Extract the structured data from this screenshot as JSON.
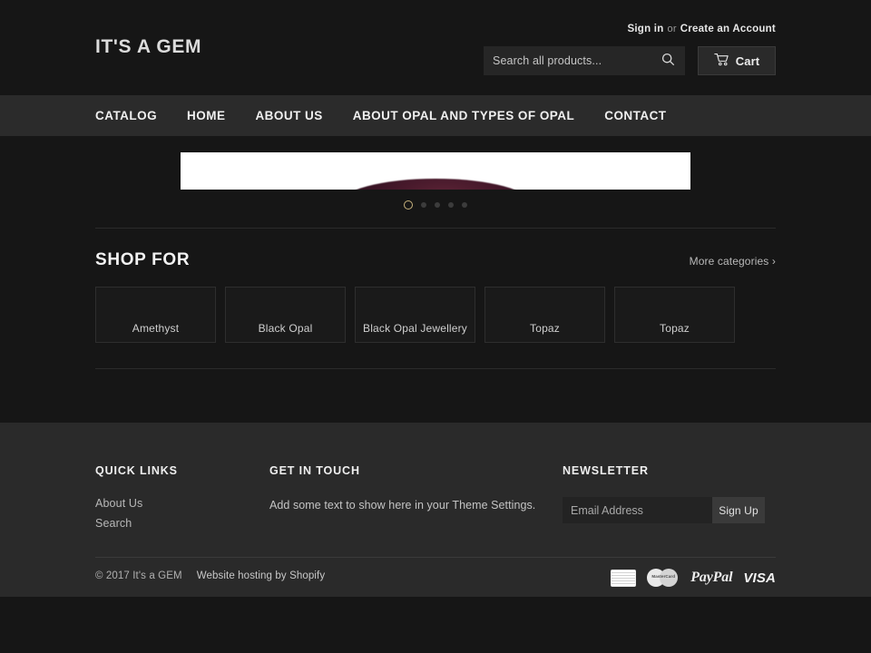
{
  "site": {
    "logo": "IT'S A GEM"
  },
  "account": {
    "sign_in": "Sign in",
    "separator": "or",
    "create_account": "Create an Account"
  },
  "search": {
    "placeholder": "Search all products...",
    "value": "",
    "icon": "search-icon"
  },
  "cart": {
    "label": "Cart",
    "icon": "shopping-cart-icon"
  },
  "nav": {
    "items": [
      {
        "label": "CATALOG"
      },
      {
        "label": "HOME"
      },
      {
        "label": "ABOUT US"
      },
      {
        "label": "ABOUT OPAL AND TYPES OF OPAL"
      },
      {
        "label": "CONTACT"
      }
    ]
  },
  "slideshow": {
    "slide_count": 5,
    "active_index": 0,
    "active_dot_color": "#c8b37e",
    "inactive_dot_color": "#3c3c3c",
    "background": "#ffffff"
  },
  "shop": {
    "title": "SHOP FOR",
    "more_link": "More categories ›",
    "categories": [
      {
        "label": "Amethyst"
      },
      {
        "label": "Black Opal"
      },
      {
        "label": "Black Opal Jewellery"
      },
      {
        "label": "Topaz"
      },
      {
        "label": "Topaz"
      }
    ]
  },
  "footer": {
    "quick_links": {
      "title": "QUICK LINKS",
      "links": [
        {
          "label": "About Us"
        },
        {
          "label": "Search"
        }
      ]
    },
    "get_in_touch": {
      "title": "GET IN TOUCH",
      "text": "Add some text to show here in your Theme Settings."
    },
    "newsletter": {
      "title": "NEWSLETTER",
      "placeholder": "Email Address",
      "value": "",
      "button": "Sign Up"
    },
    "copyright": "© 2017 It's a GEM",
    "hosting_prefix": "Website hosting by",
    "hosting_link": "Shopify",
    "payments": [
      {
        "name": "american-express"
      },
      {
        "name": "mastercard",
        "text": "MasterCard"
      },
      {
        "name": "paypal",
        "text": "PayPal"
      },
      {
        "name": "visa",
        "text": "VISA"
      }
    ]
  },
  "colors": {
    "page_bg": "#161616",
    "nav_bg": "#2b2b2b",
    "footer_bg": "#2a2a2a",
    "accent": "#c8b37e"
  }
}
